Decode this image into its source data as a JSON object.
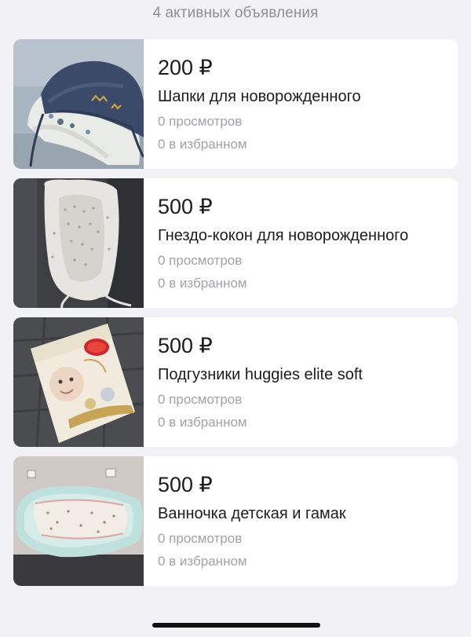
{
  "header": {
    "count_label": "4 активных объявления"
  },
  "listings": [
    {
      "price": "200 ₽",
      "title": "Шапки для новорожденного",
      "views": "0 просмотров",
      "favorites": "0 в избранном",
      "thumb_icon": "baby-hats-photo"
    },
    {
      "price": "500 ₽",
      "title": "Гнездо-кокон для новорожденного",
      "views": "0 просмотров",
      "favorites": "0 в избранном",
      "thumb_icon": "baby-nest-photo"
    },
    {
      "price": "500 ₽",
      "title": "Подгузники huggies elite soft",
      "views": "0 просмотров",
      "favorites": "0 в избранном",
      "thumb_icon": "diapers-pack-photo"
    },
    {
      "price": "500 ₽",
      "title": "Ванночка детская и гамак",
      "views": "0 просмотров",
      "favorites": "0 в избранном",
      "thumb_icon": "baby-bath-photo"
    }
  ],
  "colors": {
    "background": "#f2f2f6",
    "card": "#ffffff",
    "primary_text": "#1c1c1e",
    "secondary_text": "#a2a2a7"
  }
}
